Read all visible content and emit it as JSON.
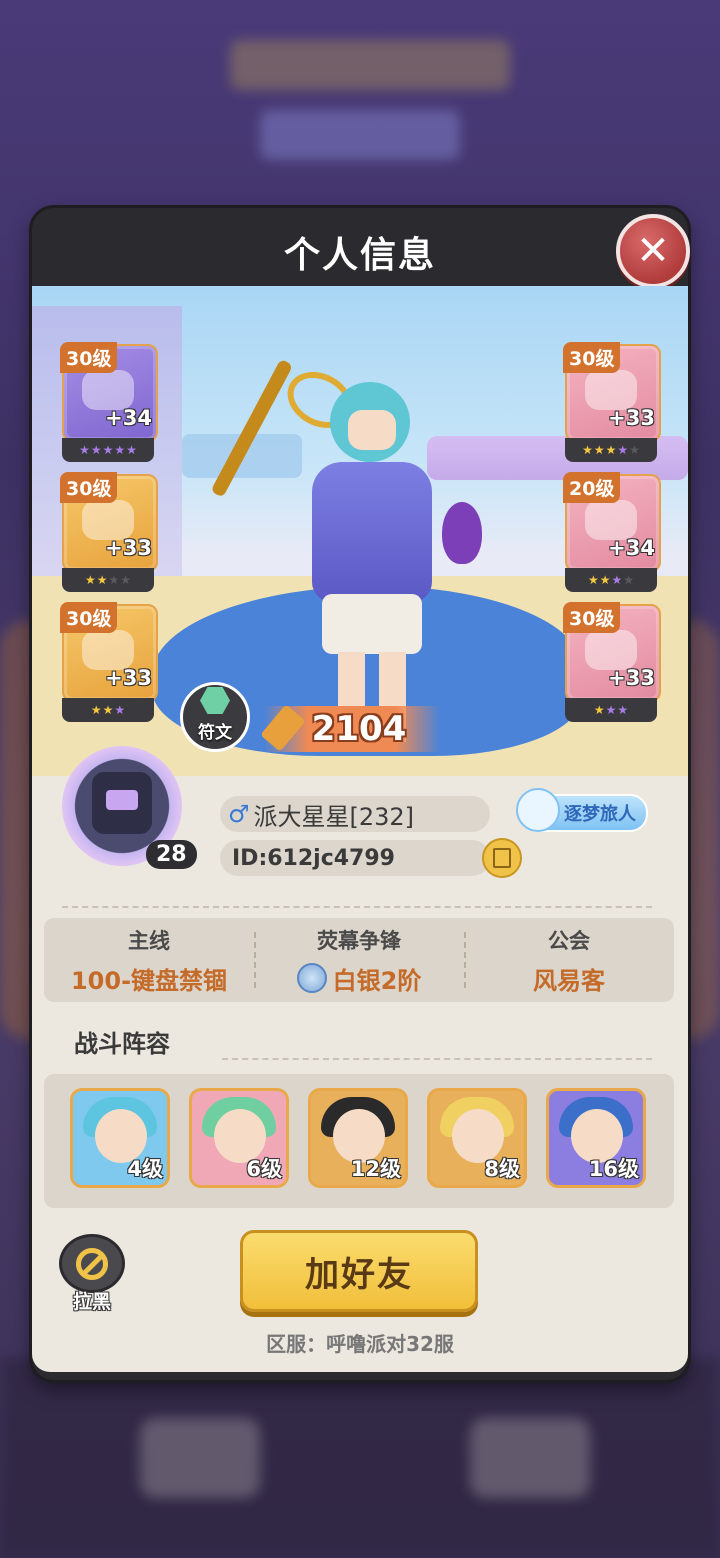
{
  "dialog": {
    "title": "个人信息",
    "close_icon": "close-icon"
  },
  "equipment_left": [
    {
      "level": "30级",
      "bonus": "+34",
      "stars": [
        "p",
        "p",
        "p",
        "p",
        "p"
      ],
      "color": "purple"
    },
    {
      "level": "30级",
      "bonus": "+33",
      "stars": [
        "g",
        "g",
        "d",
        "d"
      ],
      "color": "gold"
    },
    {
      "level": "30级",
      "bonus": "+33",
      "stars": [
        "g",
        "g",
        "p"
      ],
      "color": "gold"
    }
  ],
  "equipment_right": [
    {
      "level": "30级",
      "bonus": "+33",
      "stars": [
        "g",
        "g",
        "g",
        "p",
        "d"
      ],
      "color": "pink"
    },
    {
      "level": "20级",
      "bonus": "+34",
      "stars": [
        "g",
        "g",
        "p",
        "d"
      ],
      "color": "pink"
    },
    {
      "level": "30级",
      "bonus": "+33",
      "stars": [
        "g",
        "p",
        "p"
      ],
      "color": "pink"
    }
  ],
  "rune": {
    "label": "符文"
  },
  "power": {
    "value": "2104"
  },
  "profile": {
    "avatar_level": "28",
    "gender_symbol": "♂",
    "name": "派大星星[232]",
    "id": "ID:612jc4799",
    "badge": "逐梦旅人"
  },
  "stats": [
    {
      "key": "主线",
      "value": "100-键盘禁锢"
    },
    {
      "key": "荧幕争锋",
      "value": "白银2阶"
    },
    {
      "key": "公会",
      "value": "风易客"
    }
  ],
  "lineup": {
    "title": "战斗阵容",
    "heroes": [
      {
        "level": "4级",
        "bg": "#7fc8ee",
        "hair": "#5ec5e0"
      },
      {
        "level": "6级",
        "bg": "#f0a8b6",
        "hair": "#6fcfa0"
      },
      {
        "level": "12级",
        "bg": "#e8b05a",
        "hair": "#2a2a2a"
      },
      {
        "level": "8级",
        "bg": "#e8b05a",
        "hair": "#f0d060"
      },
      {
        "level": "16级",
        "bg": "#8c7ee0",
        "hair": "#3b6fc9"
      }
    ]
  },
  "actions": {
    "block_label": "拉黑",
    "add_friend_label": "加好友",
    "server": "区服：呼噜派对32服"
  },
  "colors": {
    "accent_orange": "#c46b2a",
    "button_gold": "#f1bf3b",
    "close_red": "#b13c3c"
  }
}
